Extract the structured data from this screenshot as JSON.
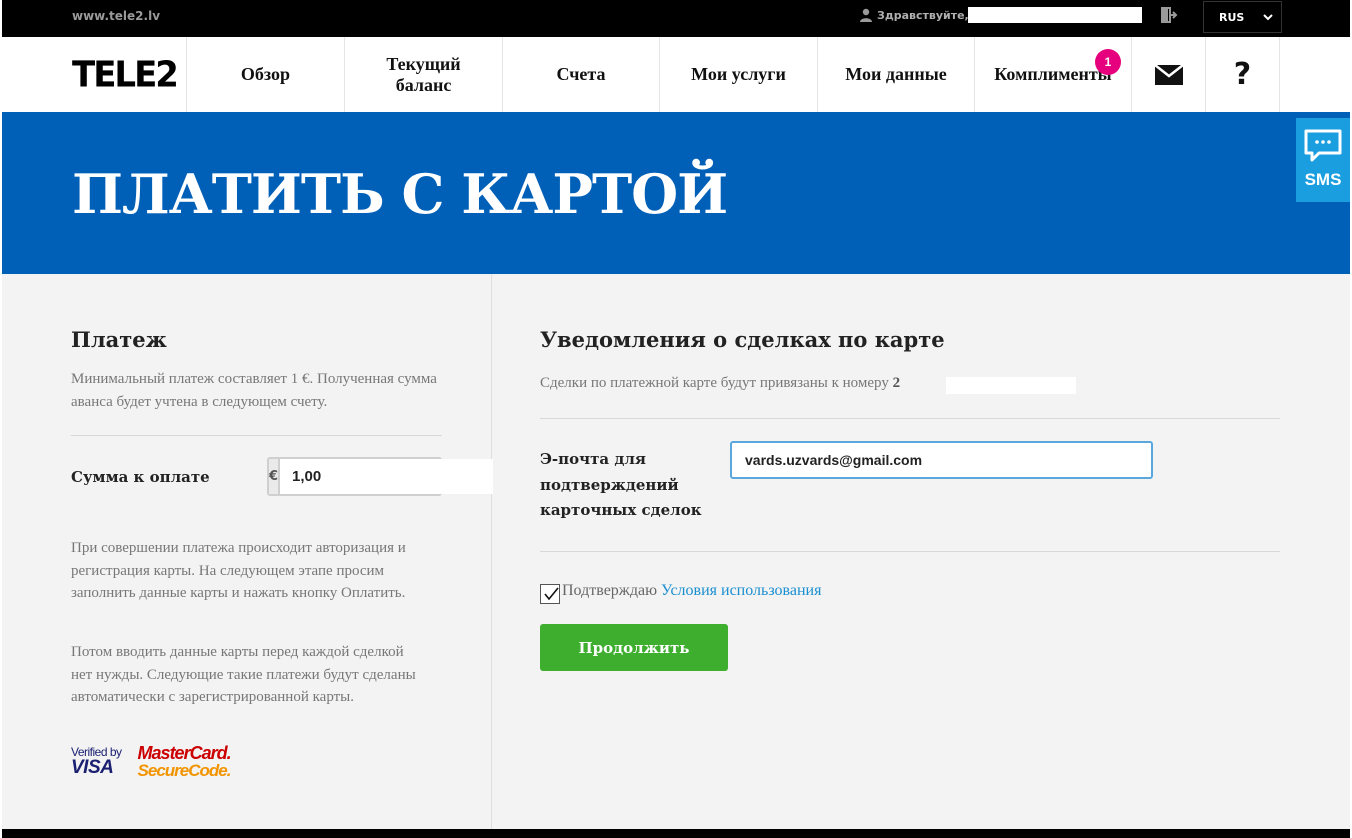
{
  "topbar": {
    "site_url": "www.tele2.lv",
    "greeting": "Здравствуйте,",
    "language": "RUS"
  },
  "brand": {
    "logo_text": "TELE2"
  },
  "nav": {
    "items": [
      {
        "label": "Обзор"
      },
      {
        "label": "Текущий баланс"
      },
      {
        "label": "Счета"
      },
      {
        "label": "Мои услуги"
      },
      {
        "label": "Мои данные"
      },
      {
        "label": "Комплименты",
        "badge": "1"
      }
    ],
    "mail_icon": "envelope-icon",
    "help_label": "?"
  },
  "hero": {
    "title": "ПЛАТИТЬ С КАРТОЙ"
  },
  "sms_tab": {
    "label": "SMS",
    "icon": "chat-bubble-icon"
  },
  "payment": {
    "heading": "Платеж",
    "min_note": "Минимальный платеж составляет 1 €. Полученная сумма аванса будет учтена в следующем счету.",
    "amount_label": "Сумма к оплате",
    "currency": "€",
    "amount_value": "1,00",
    "info_1": "При совершении платежа происходит авторизация и регистрация карты. На следующем этапе просим заполнить данные карты и нажать кнопку Оплатить.",
    "info_2": "Потом вводить данные карты перед каждой сделкой нет нужды. Следующие такие платежи будут сделаны автоматически с зарегистрированной карты.",
    "visa_line1": "Verified by",
    "visa_line2": "VISA",
    "mc_line1": "MasterCard.",
    "mc_line2": "SecureCode."
  },
  "notifications": {
    "heading": "Уведомления о сделках по карте",
    "linked_text": "Сделки по платежной карте будут привязаны к номеру",
    "linked_number": "2",
    "email_label": "Э-почта для подтверждений карточных сделок",
    "email_value": "vards.uzvards@gmail.com",
    "confirm_text": "Подтверждаю",
    "terms_link": "Условия использования",
    "checkbox_checked": true,
    "continue_label": "Продолжить"
  },
  "colors": {
    "hero_blue": "#0060b8",
    "sms_blue": "#1a9ee0",
    "continue_green": "#3eae2f",
    "badge_pink": "#e6007e",
    "link_blue": "#1a8fd0"
  }
}
